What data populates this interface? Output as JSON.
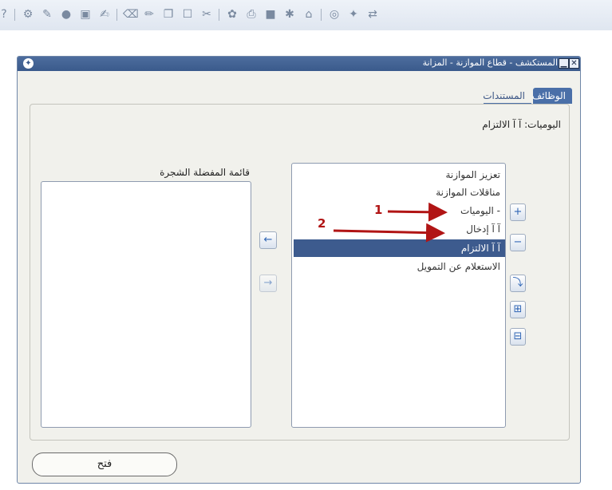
{
  "toolbar": {
    "items": [
      {
        "name": "help-icon",
        "glyph": "?"
      },
      {
        "name": "tools-icon",
        "glyph": "⚙"
      },
      {
        "name": "attachment-icon",
        "glyph": "✎"
      },
      {
        "name": "record-icon",
        "glyph": "●"
      },
      {
        "name": "window-icon",
        "glyph": "▣"
      },
      {
        "name": "edit-icon",
        "glyph": "✍"
      },
      {
        "name": "clear-icon",
        "glyph": "⌫"
      },
      {
        "name": "pencil-icon",
        "glyph": "✏"
      },
      {
        "name": "copy-icon",
        "glyph": "❐"
      },
      {
        "name": "paste-icon",
        "glyph": "☐"
      },
      {
        "name": "cut-icon",
        "glyph": "✂"
      },
      {
        "name": "folder-icon",
        "glyph": "✿"
      },
      {
        "name": "print-icon",
        "glyph": "⎙"
      },
      {
        "name": "save-icon",
        "glyph": "■"
      },
      {
        "name": "zoom-icon",
        "glyph": "✱"
      },
      {
        "name": "note-icon",
        "glyph": "⌂"
      },
      {
        "name": "translate-icon",
        "glyph": "◎"
      },
      {
        "name": "wrench-icon",
        "glyph": "✦"
      },
      {
        "name": "switch-icon",
        "glyph": "⇄"
      }
    ]
  },
  "window": {
    "title": "المستكشف - قطاع الموازنة - المزانة",
    "close_glyph": "✕",
    "minimize_glyph": "▁",
    "logo_glyph": "✦"
  },
  "tabs": [
    {
      "label": "الوظائف",
      "active": true
    },
    {
      "label": "المستندات",
      "active": false
    }
  ],
  "breadcrumb": "اليوميات: آ آ  الالتزام",
  "functions_list": {
    "items": [
      {
        "label": "تعزيز الموازنة",
        "selected": false
      },
      {
        "label": "مناقلات الموازنة",
        "selected": false
      },
      {
        "label": "-  اليوميات",
        "selected": false
      },
      {
        "label": "آ آ    إدخال",
        "selected": false
      },
      {
        "label": "آ آ    الالتزام",
        "selected": true
      },
      {
        "label": "الاستعلام عن التمويل",
        "selected": false
      }
    ]
  },
  "favorites": {
    "label": "قائمة المفضلة الشجرة"
  },
  "buttons": {
    "add_to_favorites": "←",
    "remove_from_favorites": "→",
    "expand": "+",
    "collapse": "−",
    "expand_branch": "⤵",
    "expand_all": "⊞",
    "collapse_all": "⊟"
  },
  "open_button": {
    "label": "فتح"
  },
  "annotations": [
    "1",
    "2"
  ],
  "colors": {
    "title_bar": "#3a5a8c",
    "selection": "#3d5b8e",
    "annotation": "#b11515"
  }
}
